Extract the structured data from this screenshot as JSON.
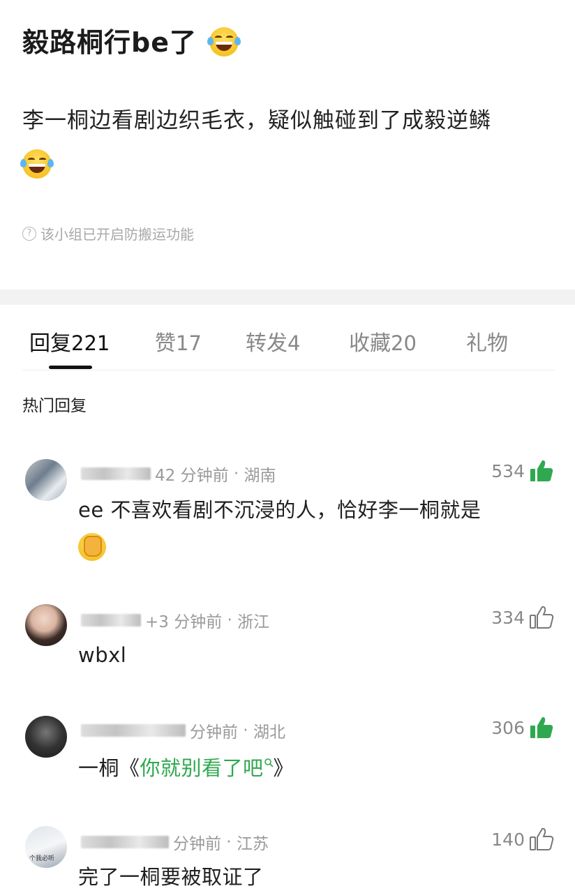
{
  "post": {
    "title": "毅路桐行be了",
    "body": "李一桐边看剧边织毛衣，疑似触碰到了成毅逆鳞",
    "notice": "该小组已开启防搬运功能"
  },
  "tabs": [
    {
      "label": "回复",
      "count": "221",
      "active": true
    },
    {
      "label": "赞",
      "count": "17"
    },
    {
      "label": "转发",
      "count": "4"
    },
    {
      "label": "收藏",
      "count": "20"
    },
    {
      "label": "礼物",
      "count": ""
    }
  ],
  "section_title": "热门回复",
  "comments": [
    {
      "time": "42 分钟前",
      "location": "湖南",
      "likes": "534",
      "liked": true,
      "text": "ee 不喜欢看剧不沉浸的人，恰好李一桐就是"
    },
    {
      "time": "+3 分钟前",
      "location": "浙江",
      "likes": "334",
      "liked": false,
      "text": "wbxl"
    },
    {
      "time": "分钟前",
      "location": "湖北",
      "likes": "306",
      "liked": true,
      "text_prefix": "一桐《",
      "link_text": "你就别看了吧",
      "text_suffix": "》"
    },
    {
      "time": "分钟前",
      "location": "江苏",
      "likes": "140",
      "liked": false,
      "text": "完了一桐要被取证了",
      "avatar_caption": "个我必听"
    }
  ],
  "colors": {
    "like_green": "#2fa84f",
    "link_green": "#2fa84f",
    "meta_gray": "#9a9a9a"
  }
}
